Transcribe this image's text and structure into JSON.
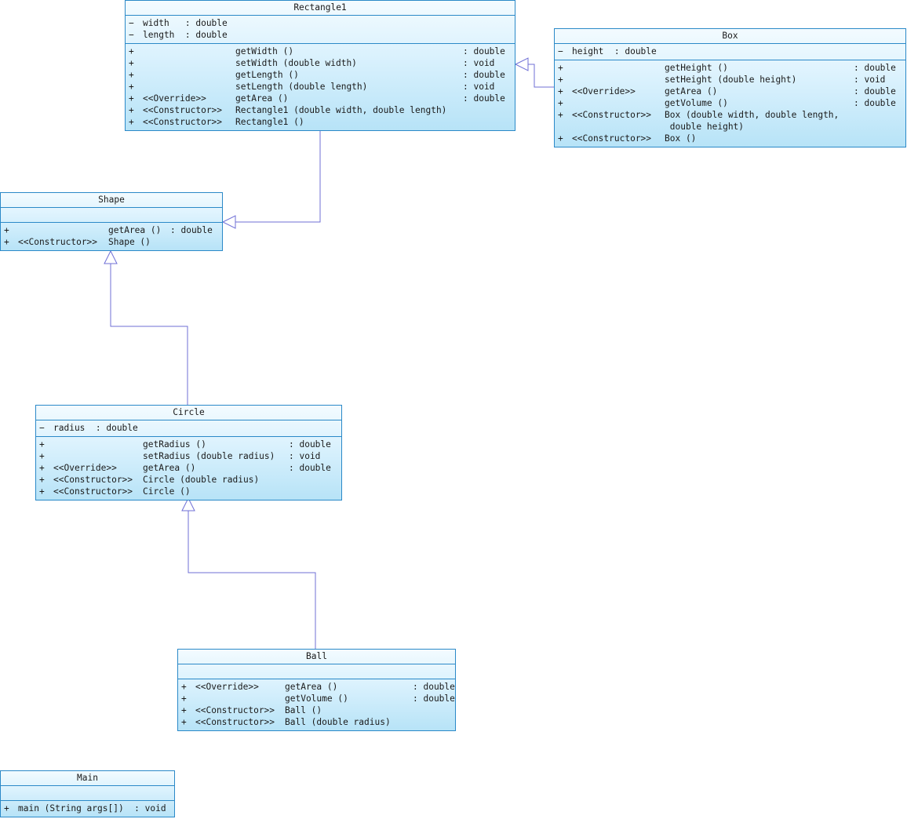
{
  "classes": {
    "rectangle1": {
      "name": "Rectangle1",
      "attributes": [
        {
          "vis": "−",
          "text": "width   : double"
        },
        {
          "vis": "−",
          "text": "length  : double"
        }
      ],
      "methods": [
        {
          "vis": "+",
          "stereo": "",
          "sig": "getWidth ()",
          "type": ": double"
        },
        {
          "vis": "+",
          "stereo": "",
          "sig": "setWidth (double width)",
          "type": ": void"
        },
        {
          "vis": "+",
          "stereo": "",
          "sig": "getLength ()",
          "type": ": double"
        },
        {
          "vis": "+",
          "stereo": "",
          "sig": "setLength (double length)",
          "type": ": void"
        },
        {
          "vis": "+",
          "stereo": "<<Override>>",
          "sig": "getArea ()",
          "type": ": double"
        },
        {
          "vis": "+",
          "stereo": "<<Constructor>>",
          "sig": "Rectangle1 (double width, double length)",
          "type": ""
        },
        {
          "vis": "+",
          "stereo": "<<Constructor>>",
          "sig": "Rectangle1 ()",
          "type": ""
        }
      ]
    },
    "box": {
      "name": "Box",
      "attributes": [
        {
          "vis": "−",
          "text": "height  : double"
        }
      ],
      "methods": [
        {
          "vis": "+",
          "stereo": "",
          "sig": "getHeight ()",
          "type": ": double"
        },
        {
          "vis": "+",
          "stereo": "",
          "sig": "setHeight (double height)",
          "type": ": void"
        },
        {
          "vis": "+",
          "stereo": "<<Override>>",
          "sig": "getArea ()",
          "type": ": double"
        },
        {
          "vis": "+",
          "stereo": "",
          "sig": "getVolume ()",
          "type": ": double"
        },
        {
          "vis": "+",
          "stereo": "<<Constructor>>",
          "sig": "Box (double width, double length,",
          "sig2": " double height)",
          "type": ""
        },
        {
          "vis": "+",
          "stereo": "<<Constructor>>",
          "sig": "Box ()",
          "type": ""
        }
      ]
    },
    "shape": {
      "name": "Shape",
      "attributes": [],
      "methods": [
        {
          "vis": "+",
          "stereo": "",
          "sig": "getArea ()",
          "type": ": double"
        },
        {
          "vis": "+",
          "stereo": "<<Constructor>>",
          "sig": "Shape ()",
          "type": ""
        }
      ]
    },
    "circle": {
      "name": "Circle",
      "attributes": [
        {
          "vis": "−",
          "text": "radius  : double"
        }
      ],
      "methods": [
        {
          "vis": "+",
          "stereo": "",
          "sig": "getRadius ()",
          "type": ": double"
        },
        {
          "vis": "+",
          "stereo": "",
          "sig": "setRadius (double radius)",
          "type": ": void"
        },
        {
          "vis": "+",
          "stereo": "<<Override>>",
          "sig": "getArea ()",
          "type": ": double"
        },
        {
          "vis": "+",
          "stereo": "<<Constructor>>",
          "sig": "Circle (double radius)",
          "type": ""
        },
        {
          "vis": "+",
          "stereo": "<<Constructor>>",
          "sig": "Circle ()",
          "type": ""
        }
      ]
    },
    "ball": {
      "name": "Ball",
      "attributes": [],
      "methods": [
        {
          "vis": "+",
          "stereo": "<<Override>>",
          "sig": "getArea ()",
          "type": ": double"
        },
        {
          "vis": "+",
          "stereo": "",
          "sig": "getVolume ()",
          "type": ": double"
        },
        {
          "vis": "+",
          "stereo": "<<Constructor>>",
          "sig": "Ball ()",
          "type": ""
        },
        {
          "vis": "+",
          "stereo": "<<Constructor>>",
          "sig": "Ball (double radius)",
          "type": ""
        }
      ]
    },
    "main": {
      "name": "Main",
      "attributes": [],
      "methods": [
        {
          "vis": "+",
          "stereo": "",
          "sig": "main (String args[])  : void",
          "type": ""
        }
      ]
    }
  },
  "colors": {
    "border": "#2b89c8",
    "connector": "#6f6fd6",
    "fill_top": "#f3fbff",
    "fill_bottom": "#b7e3f7"
  }
}
